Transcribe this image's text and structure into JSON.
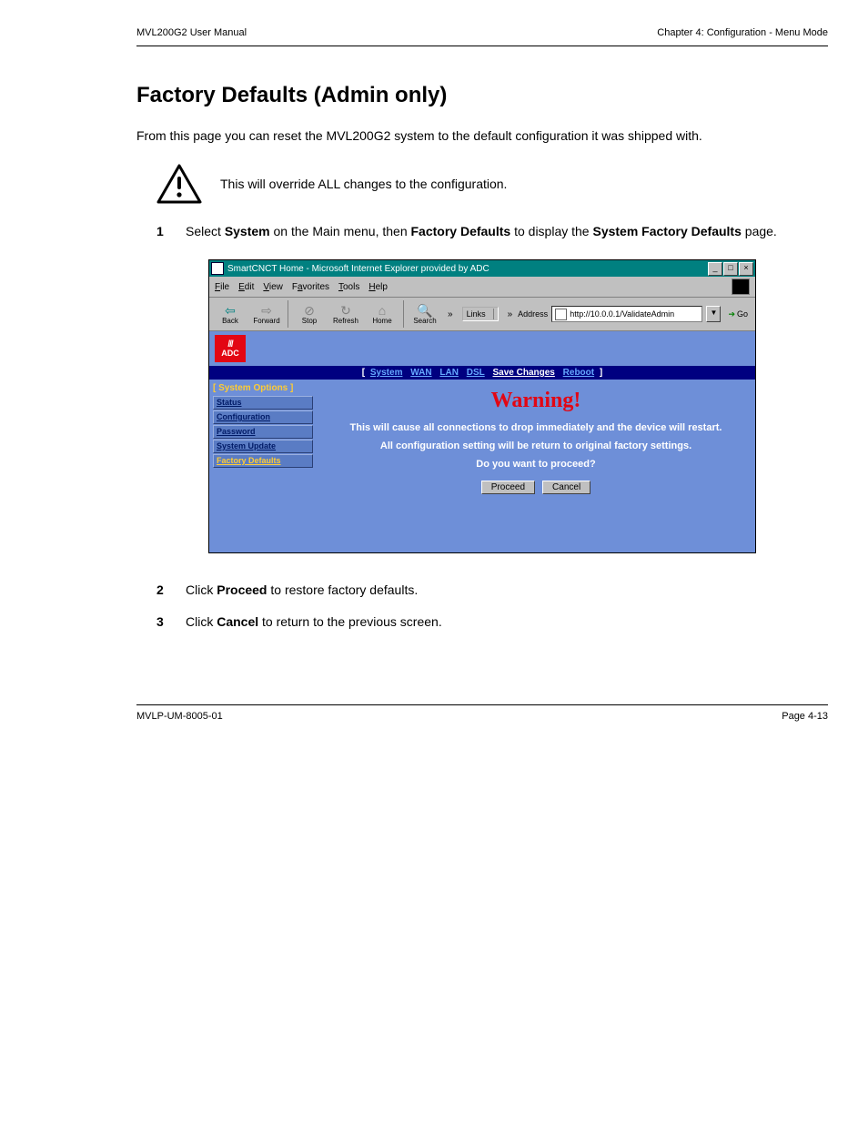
{
  "header": {
    "left": "MVL200G2 User Manual",
    "right": "Chapter 4: Configuration - Menu Mode"
  },
  "section_title": "Factory Defaults (Admin only)",
  "intro_text": "From this page you can reset the MVL200G2 system to the default configuration it was shipped with.",
  "note_text": "This will override ALL changes to the configuration.",
  "step1": {
    "num": "1",
    "pre": "Select ",
    "b1": "System",
    "mid1": " on the Main menu, then ",
    "b2": "Factory Defaults",
    "mid2": " to display the ",
    "b3": "System Factory Defaults",
    "post": " page."
  },
  "step2": {
    "num": "2",
    "pre": "Click ",
    "b1": "Proceed",
    "post": " to restore factory defaults."
  },
  "step3": {
    "num": "3",
    "pre": "Click ",
    "b1": "Cancel",
    "post": " to return to the previous screen."
  },
  "ss": {
    "title": "SmartCNCT Home - Microsoft Internet Explorer provided by ADC",
    "win_min": "_",
    "win_max": "□",
    "win_close": "×",
    "menu": {
      "file": "File",
      "edit": "Edit",
      "view": "View",
      "fav": "Favorites",
      "tools": "Tools",
      "help": "Help"
    },
    "tb": {
      "back": "Back",
      "forward": "Forward",
      "stop": "Stop",
      "refresh": "Refresh",
      "home": "Home",
      "search": "Search"
    },
    "chev": "»",
    "links_label": "Links",
    "addr_label": "Address",
    "url": "http://10.0.0.1/ValidateAdmin",
    "go": "Go",
    "logo_bars": "///",
    "logo_text": "ADC",
    "nav": {
      "lb": "[",
      "rb": "]",
      "system": "System",
      "wan": "WAN",
      "lan": "LAN",
      "dsl": "DSL",
      "save": "Save Changes",
      "reboot": "Reboot"
    },
    "side": {
      "head_lb": "[ ",
      "head": "System Options",
      "head_rb": " ]",
      "status": "Status",
      "config": "Configuration",
      "password": "Password",
      "update": "System Update",
      "factory": "Factory Defaults"
    },
    "warning": "Warning!",
    "msg1": "This will cause all connections to drop immediately and the device will restart.",
    "msg2": "All configuration setting will be return to original factory settings.",
    "msg3": "Do you want to proceed?",
    "proceed": "Proceed",
    "cancel": "Cancel"
  },
  "footer": {
    "left": "MVLP-UM-8005-01",
    "right": "Page 4-13"
  }
}
